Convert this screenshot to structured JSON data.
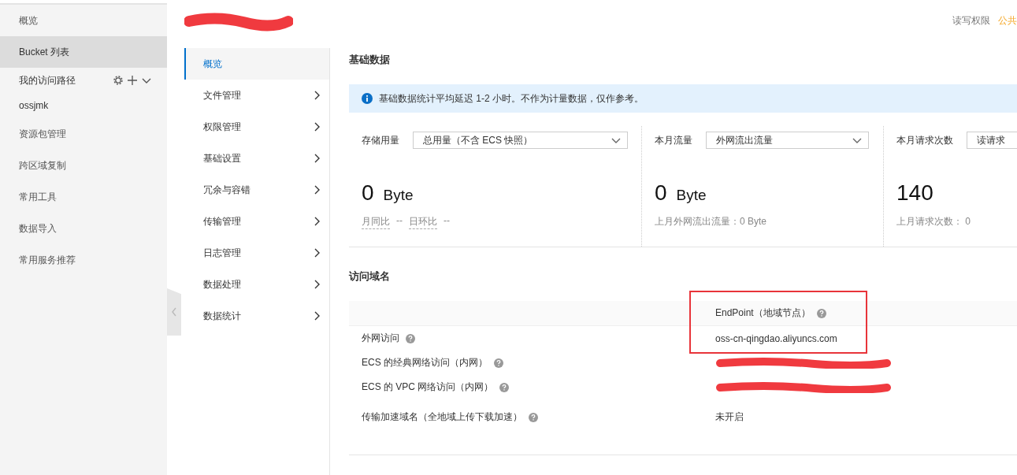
{
  "sidebar": {
    "items": [
      {
        "kind": "item",
        "label": "概览",
        "selected": false
      },
      {
        "kind": "item",
        "label": "Bucket 列表",
        "selected": true
      },
      {
        "kind": "group",
        "label": "我的访问路径",
        "selected": false,
        "expanded": true
      },
      {
        "kind": "path",
        "label": "ossjmk",
        "selected": false
      },
      {
        "kind": "item",
        "label": "资源包管理",
        "selected": false
      },
      {
        "kind": "item",
        "label": "跨区域复制",
        "selected": false
      },
      {
        "kind": "item",
        "label": "常用工具",
        "selected": false
      },
      {
        "kind": "item",
        "label": "数据导入",
        "selected": false
      },
      {
        "kind": "item",
        "label": "常用服务推荐",
        "selected": false
      }
    ]
  },
  "bucket": {
    "name_redacted": true,
    "acl_label": "读写权限",
    "acl_value": "公共"
  },
  "nav": {
    "items": [
      {
        "label": "概览",
        "selected": true,
        "expandable": false
      },
      {
        "label": "文件管理",
        "selected": false,
        "expandable": true
      },
      {
        "label": "权限管理",
        "selected": false,
        "expandable": true
      },
      {
        "label": "基础设置",
        "selected": false,
        "expandable": true
      },
      {
        "label": "冗余与容错",
        "selected": false,
        "expandable": true
      },
      {
        "label": "传输管理",
        "selected": false,
        "expandable": true
      },
      {
        "label": "日志管理",
        "selected": false,
        "expandable": true
      },
      {
        "label": "数据处理",
        "selected": false,
        "expandable": true
      },
      {
        "label": "数据统计",
        "selected": false,
        "expandable": true
      }
    ]
  },
  "basic_data": {
    "title": "基础数据",
    "notice": "基础数据统计平均延迟 1-2 小时。不作为计量数据，仅作参考。",
    "stats": [
      {
        "label": "存储用量",
        "select": "总用量（不含 ECS 快照）",
        "value": "0",
        "unit": "Byte",
        "footer": [
          {
            "kind": "compare",
            "label": "月同比",
            "value": "--"
          },
          {
            "kind": "compare",
            "label": "日环比",
            "value": "--"
          }
        ]
      },
      {
        "label": "本月流量",
        "select": "外网流出流量",
        "value": "0",
        "unit": "Byte",
        "footer": [
          {
            "kind": "text",
            "label": "上月外网流出流量：0 Byte"
          }
        ]
      },
      {
        "label": "本月请求次数",
        "select": "读请求",
        "value": "140",
        "footer": [
          {
            "kind": "text",
            "label": "上月请求次数：  0"
          }
        ]
      }
    ]
  },
  "domains": {
    "title": "访问域名",
    "column_2": "EndPoint（地域节点）",
    "highlight_box": true,
    "rows": [
      {
        "label": "外网访问",
        "value": "oss-cn-qingdao.aliyuncs.com",
        "redacted": false
      },
      {
        "label": "ECS 的经典网络访问（内网）",
        "redacted": true
      },
      {
        "label": "ECS 的 VPC 网络访问（内网）",
        "redacted": true
      },
      {
        "label": "传输加速域名（全地域上传下载加速）",
        "value": "未开启",
        "redacted": false
      }
    ]
  }
}
